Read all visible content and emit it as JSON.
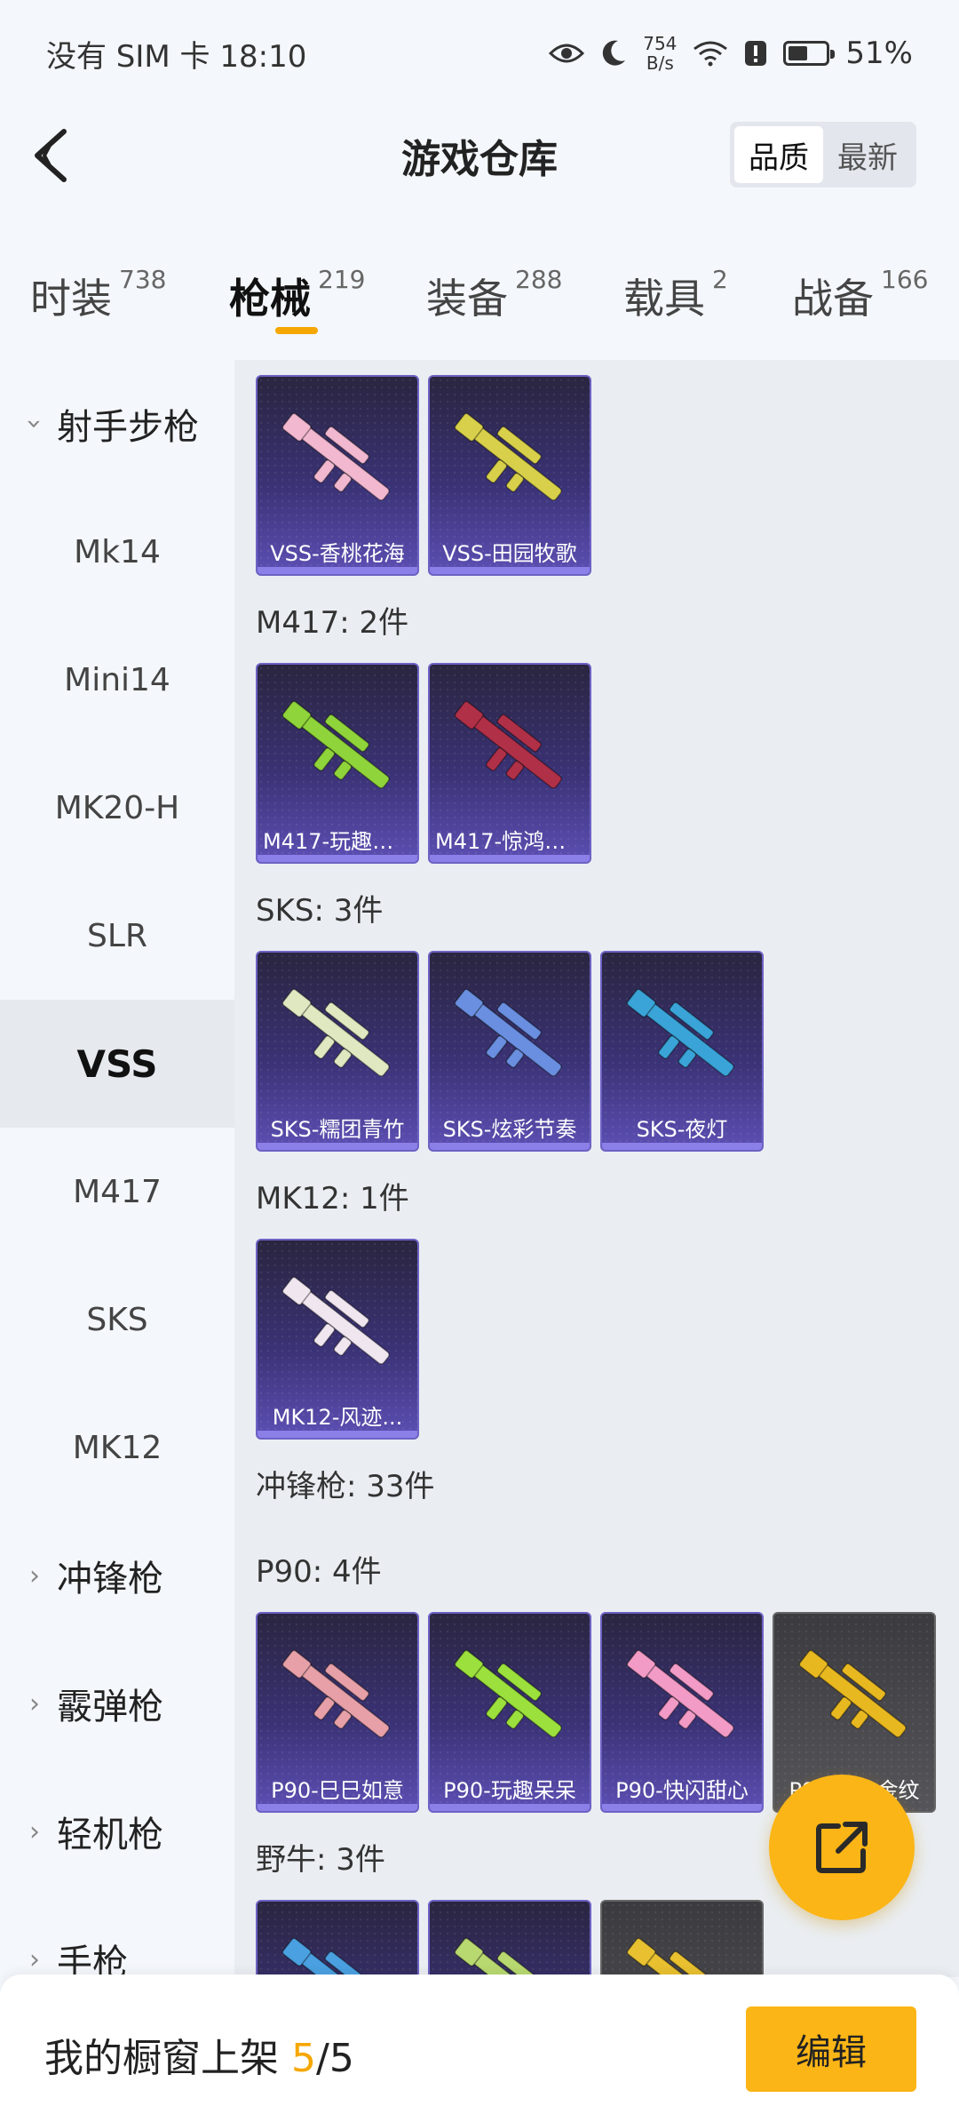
{
  "status_bar": {
    "carrier_time": "没有 SIM 卡 18:10",
    "net_speed_value": "754",
    "net_speed_unit": "B/s",
    "battery_percent": "51%",
    "battery_level": 0.51
  },
  "header": {
    "title": "游戏仓库",
    "sort_options": [
      "品质",
      "最新"
    ],
    "active_sort": "品质"
  },
  "category_tabs": [
    {
      "label": "时装",
      "count": "738"
    },
    {
      "label": "枪械",
      "count": "219"
    },
    {
      "label": "装备",
      "count": "288"
    },
    {
      "label": "载具",
      "count": "2"
    },
    {
      "label": "战备",
      "count": "166"
    }
  ],
  "active_category": "枪械",
  "sidebar": {
    "items": [
      {
        "label": "射手步枪",
        "type": "group",
        "expanded": true
      },
      {
        "label": "Mk14",
        "type": "item"
      },
      {
        "label": "Mini14",
        "type": "item"
      },
      {
        "label": "MK20-H",
        "type": "item"
      },
      {
        "label": "SLR",
        "type": "item"
      },
      {
        "label": "VSS",
        "type": "item",
        "active": true
      },
      {
        "label": "M417",
        "type": "item"
      },
      {
        "label": "SKS",
        "type": "item"
      },
      {
        "label": "MK12",
        "type": "item"
      },
      {
        "label": "冲锋枪",
        "type": "group"
      },
      {
        "label": "霰弹枪",
        "type": "group"
      },
      {
        "label": "轻机枪",
        "type": "group"
      },
      {
        "label": "手枪",
        "type": "group"
      }
    ]
  },
  "content": {
    "section_titles": [
      "M417: 2件",
      "SKS: 3件",
      "MK12: 1件",
      "冲锋枪: 33件",
      "P90: 4件",
      "野牛: 3件"
    ],
    "vss_items": [
      {
        "name": "VSS-香桃花海",
        "color": "#f2b8cf"
      },
      {
        "name": "VSS-田园牧歌",
        "color": "#d8d04a"
      }
    ],
    "m417_items": [
      {
        "name": "M417-玩趣呆...",
        "color": "#8fd43a"
      },
      {
        "name": "M417-惊鸿侠...",
        "color": "#b03048"
      }
    ],
    "sks_items": [
      {
        "name": "SKS-糯团青竹",
        "color": "#dfe8c0"
      },
      {
        "name": "SKS-炫彩节奏",
        "color": "#6a8fe0"
      },
      {
        "name": "SKS-夜灯",
        "color": "#3aa4d8"
      }
    ],
    "mk12_items": [
      {
        "name": "MK12-风迹...",
        "color": "#f0e6f0"
      }
    ],
    "p90_items": [
      {
        "name": "P90-巳巳如意",
        "color": "#e7a0a8"
      },
      {
        "name": "P90-玩趣呆呆",
        "color": "#9be03c"
      },
      {
        "name": "P90-快闪甜心",
        "color": "#f29bc6"
      },
      {
        "name": "P90-□□金纹",
        "color": "#e8b820",
        "gray": true
      }
    ],
    "bison_items": [
      {
        "name": "",
        "color": "#4aa0e0"
      },
      {
        "name": "",
        "color": "#b8d870"
      },
      {
        "name": "",
        "color": "#e8c030",
        "gray": true
      }
    ]
  },
  "bottom_bar": {
    "label": "我的橱窗上架 ",
    "current": "5",
    "total": "/5",
    "edit_label": "编辑"
  }
}
